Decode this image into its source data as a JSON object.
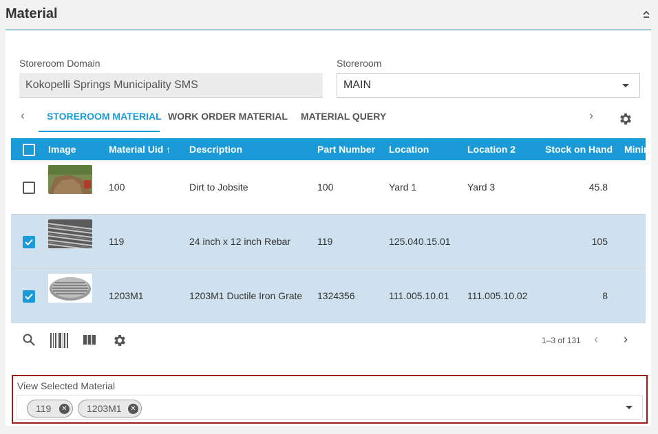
{
  "panel": {
    "title": "Material"
  },
  "fields": {
    "storeroom_domain_label": "Storeroom Domain",
    "storeroom_domain_value": "Kokopelli Springs Municipality SMS",
    "storeroom_label": "Storeroom",
    "storeroom_value": "MAIN"
  },
  "tabs": [
    {
      "label": "STOREROOM MATERIAL",
      "active": true
    },
    {
      "label": "WORK ORDER MATERIAL",
      "active": false
    },
    {
      "label": "MATERIAL QUERY",
      "active": false
    }
  ],
  "table": {
    "headers": {
      "image": "Image",
      "material_uid": "Material Uid",
      "description": "Description",
      "part_number": "Part Number",
      "location": "Location",
      "location2": "Location 2",
      "stock_on_hand": "Stock on Hand",
      "minimum": "Minim"
    },
    "rows": [
      {
        "uid": "100",
        "description": "Dirt to Jobsite",
        "part_number": "100",
        "location": "Yard 1",
        "location2": "Yard 3",
        "stock": "45.8",
        "selected": false,
        "image": "dirt-photo"
      },
      {
        "uid": "119",
        "description": "24 inch x 12 inch Rebar",
        "part_number": "119",
        "location": "125.040.15.01",
        "location2": "",
        "stock": "105",
        "selected": true,
        "image": "rebar-photo"
      },
      {
        "uid": "1203M1",
        "description": "1203M1 Ductile Iron Grate",
        "part_number": "1324356",
        "location": "111.005.10.01",
        "location2": "111.005.10.02",
        "stock": "8",
        "selected": true,
        "image": "grate-photo"
      }
    ]
  },
  "pager": {
    "text": "1–3 of 131"
  },
  "view_selected": {
    "label": "View Selected Material",
    "chips": [
      "119",
      "1203M1"
    ]
  },
  "colors": {
    "accent": "#1a9bd7",
    "selected_row": "#cfe1ee",
    "highlight_border": "#9a1b1b",
    "header_line": "#1c8b9a"
  }
}
